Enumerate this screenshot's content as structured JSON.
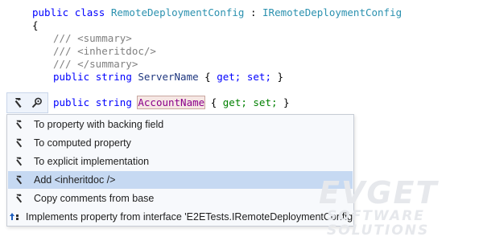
{
  "code": {
    "line1": {
      "kw1": "public",
      "kw2": "class",
      "name": "RemoteDeploymentConfig",
      "sep": ":",
      "iface": "IRemoteDeploymentConfig"
    },
    "line2": "{",
    "line3": "/// <summary>",
    "line4": "/// <inheritdoc/>",
    "line5": "/// </summary>",
    "line6": {
      "kw1": "public",
      "kw2": "string",
      "name": "ServerName",
      "open": "{",
      "get": "get;",
      "set": "set;",
      "close": "}"
    },
    "line7": {
      "kw1": "public",
      "kw2": "string",
      "name": "AccountName",
      "open": "{",
      "get": "get;",
      "set": "set;",
      "close": "}"
    }
  },
  "icons": {
    "bulb_primary": "hammer-icon",
    "bulb_secondary": "inspect-icon"
  },
  "menu": {
    "items": [
      {
        "label": "To property with backing field",
        "icon": "hammer-icon"
      },
      {
        "label": "To computed property",
        "icon": "hammer-icon"
      },
      {
        "label": "To explicit implementation",
        "icon": "hammer-icon"
      },
      {
        "label": "Add <inheritdoc />",
        "icon": "hammer-icon",
        "selected": true
      },
      {
        "label": "Copy comments from base",
        "icon": "hammer-icon"
      },
      {
        "label": "Implements property from interface 'E2ETests.IRemoteDeploymentConfig'",
        "icon": "implements-icon"
      }
    ]
  },
  "watermark": {
    "line1": "EVGET",
    "line2": "SOFTWARE SOLUTIONS"
  },
  "colors": {
    "keyword": "#0000ff",
    "comment": "#808080",
    "type": "#2b91af",
    "selection": "#c6d9f2",
    "menu_bg": "#f7f9fc"
  }
}
